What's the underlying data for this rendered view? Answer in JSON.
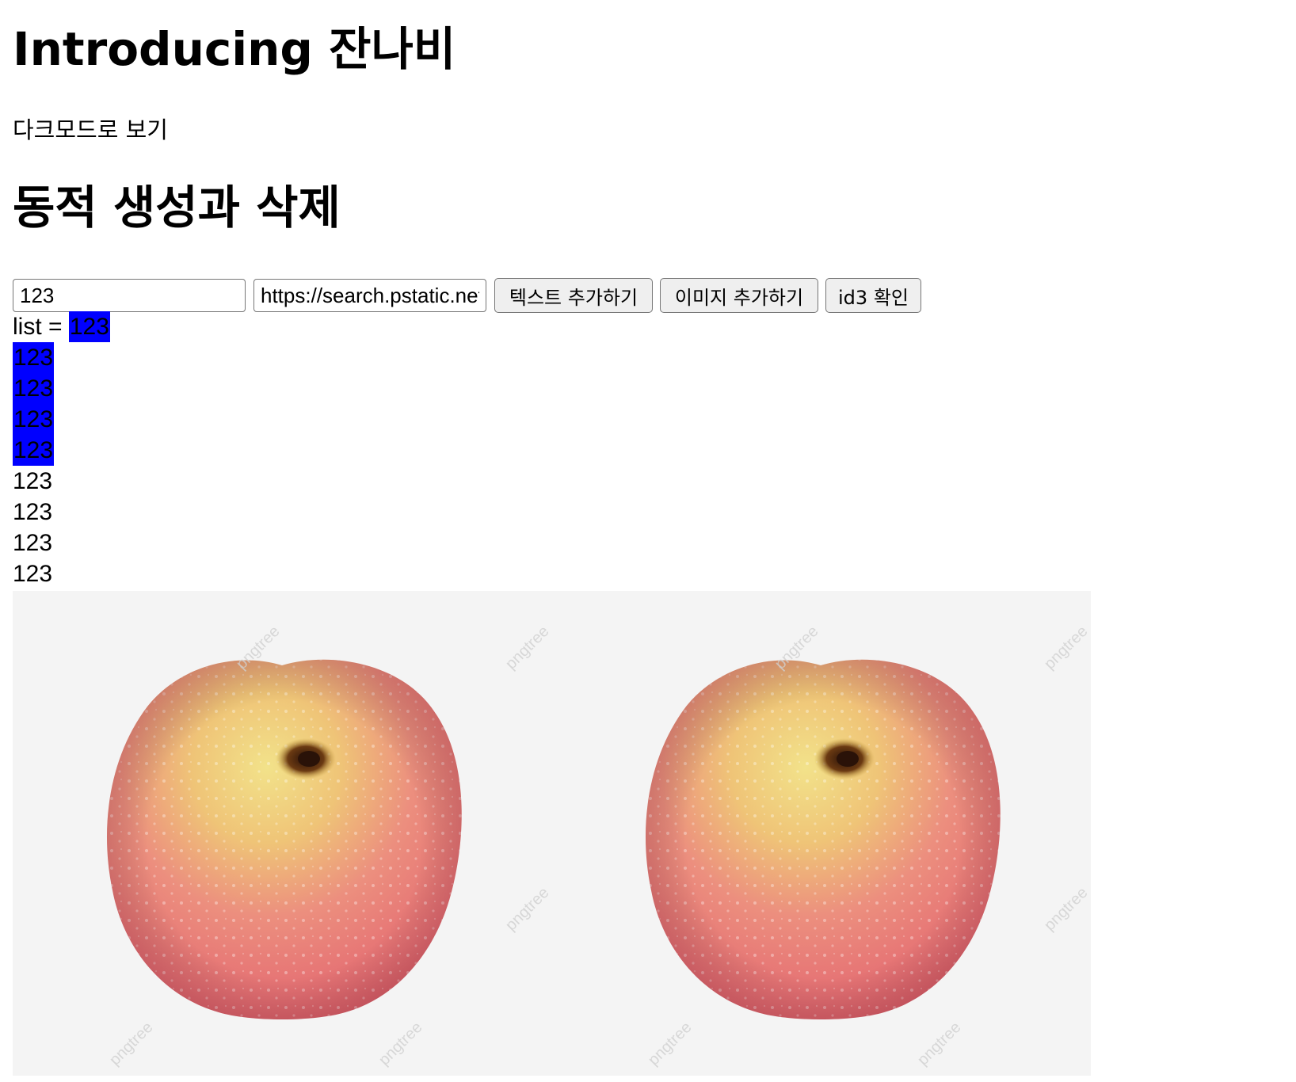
{
  "header": {
    "title": "Introducing 잔나비",
    "dark_mode_link": "다크모드로 보기"
  },
  "section": {
    "title": "동적 생성과 삭제"
  },
  "controls": {
    "text_input_value": "123",
    "url_input_value": "https://search.pstatic.net",
    "add_text_button": "텍스트 추가하기",
    "add_image_button": "이미지 추가하기",
    "check_id3_button": "id3 확인"
  },
  "list": {
    "label": "list = ",
    "items": [
      {
        "text": "123",
        "highlighted": true
      },
      {
        "text": "123",
        "highlighted": true
      },
      {
        "text": "123",
        "highlighted": true
      },
      {
        "text": "123",
        "highlighted": true
      },
      {
        "text": "123",
        "highlighted": true
      },
      {
        "text": "123",
        "highlighted": false
      },
      {
        "text": "123",
        "highlighted": false
      },
      {
        "text": "123",
        "highlighted": false
      },
      {
        "text": "123",
        "highlighted": false
      }
    ]
  },
  "images": {
    "count": 2,
    "subject": "apple",
    "watermark": "pngtree"
  },
  "colors": {
    "highlight": "#0000ff",
    "image_background": "#f4f4f4",
    "button_background": "#efefef"
  }
}
